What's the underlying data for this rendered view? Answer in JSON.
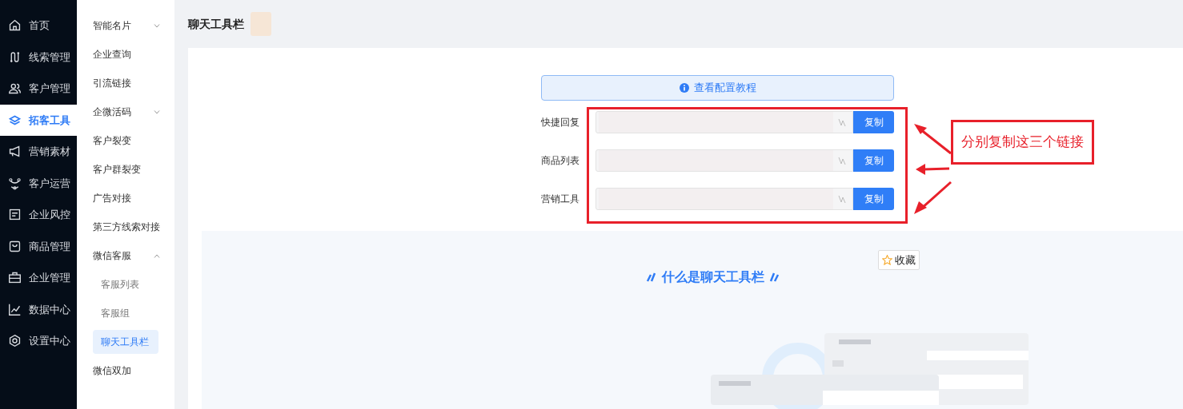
{
  "nav": [
    {
      "label": "首页",
      "selected": false
    },
    {
      "label": "线索管理",
      "selected": false
    },
    {
      "label": "客户管理",
      "selected": false
    },
    {
      "label": "拓客工具",
      "selected": true
    },
    {
      "label": "营销素材",
      "selected": false
    },
    {
      "label": "客户运营",
      "selected": false
    },
    {
      "label": "企业风控",
      "selected": false
    },
    {
      "label": "商品管理",
      "selected": false
    },
    {
      "label": "企业管理",
      "selected": false
    },
    {
      "label": "数据中心",
      "selected": false
    },
    {
      "label": "设置中心",
      "selected": false
    }
  ],
  "submenu": [
    {
      "label": "智能名片",
      "selected": false,
      "expanded": false
    },
    {
      "label": "企业查询",
      "selected": false
    },
    {
      "label": "引流链接",
      "selected": false
    },
    {
      "label": "企微活码",
      "selected": false,
      "expanded": false
    },
    {
      "label": "客户裂变",
      "selected": false
    },
    {
      "label": "客户群裂变",
      "selected": false
    },
    {
      "label": "广告对接",
      "selected": false
    },
    {
      "label": "第三方线索对接",
      "selected": false
    },
    {
      "label": "微信客服",
      "selected": false,
      "expanded": true,
      "children": [
        {
          "label": "客服列表",
          "selected": false
        },
        {
          "label": "客服组",
          "selected": false
        },
        {
          "label": "聊天工具栏",
          "selected": true
        }
      ]
    },
    {
      "label": "微信双加",
      "selected": false
    }
  ],
  "page_title": "聊天工具栏",
  "tutorial_banner": "查看配置教程",
  "links": [
    {
      "label": "快捷回复",
      "button": "复制"
    },
    {
      "label": "商品列表",
      "button": "复制"
    },
    {
      "label": "营销工具",
      "button": "复制"
    }
  ],
  "annotation": "分别复制这三个链接",
  "favorite_button": "收藏",
  "section_heading": "什么是聊天工具栏"
}
